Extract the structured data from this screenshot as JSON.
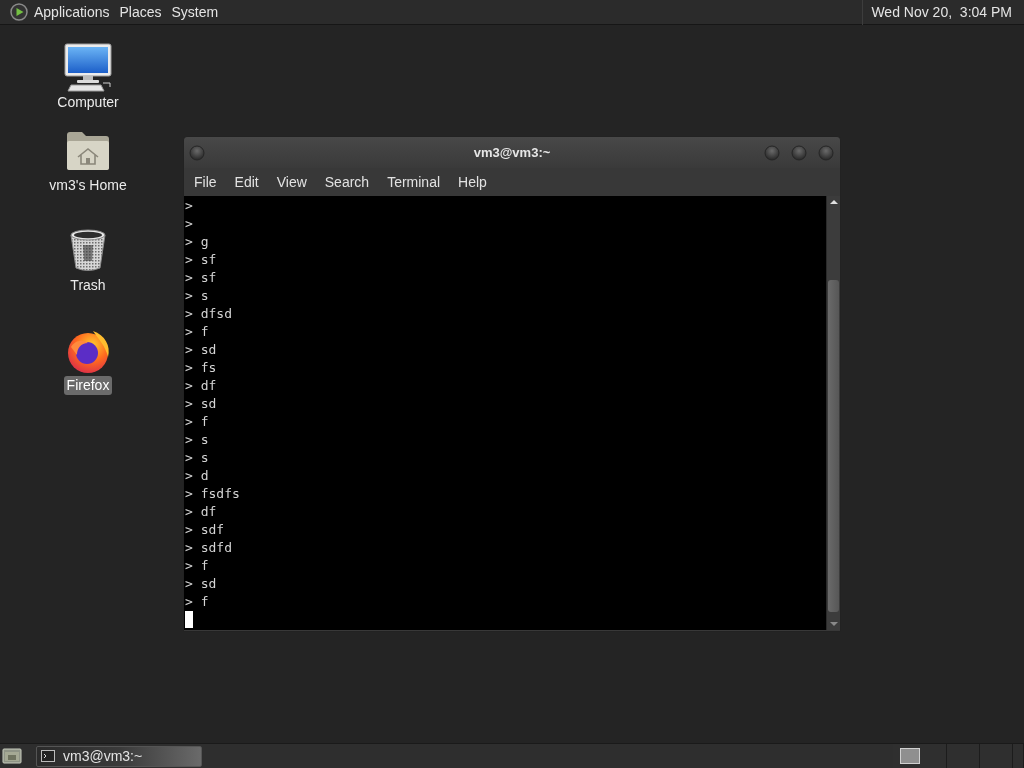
{
  "top_panel": {
    "menus": [
      "Applications",
      "Places",
      "System"
    ],
    "clock": "Wed Nov 20,  3:04 PM"
  },
  "desktop_icons": [
    {
      "kind": "computer",
      "label": "Computer",
      "selected": false
    },
    {
      "kind": "home",
      "label": "vm3's Home",
      "selected": false
    },
    {
      "kind": "trash",
      "label": "Trash",
      "selected": false
    },
    {
      "kind": "firefox",
      "label": "Firefox",
      "selected": true
    }
  ],
  "terminal_window": {
    "title": "vm3@vm3:~",
    "menus": [
      "File",
      "Edit",
      "View",
      "Search",
      "Terminal",
      "Help"
    ],
    "lines": [
      ">",
      ">",
      "> g",
      "> sf",
      "> sf",
      "> s",
      "> dfsd",
      "> f",
      "> sd",
      "> fs",
      "> df",
      "> sd",
      "> f",
      "> s",
      "> s",
      "> d",
      "> fsdfs",
      "> df",
      "> sdf",
      "> sdfd",
      "> f",
      "> sd",
      "> f"
    ]
  },
  "bottom_panel": {
    "tasks": [
      {
        "label": "vm3@vm3:~"
      }
    ]
  }
}
